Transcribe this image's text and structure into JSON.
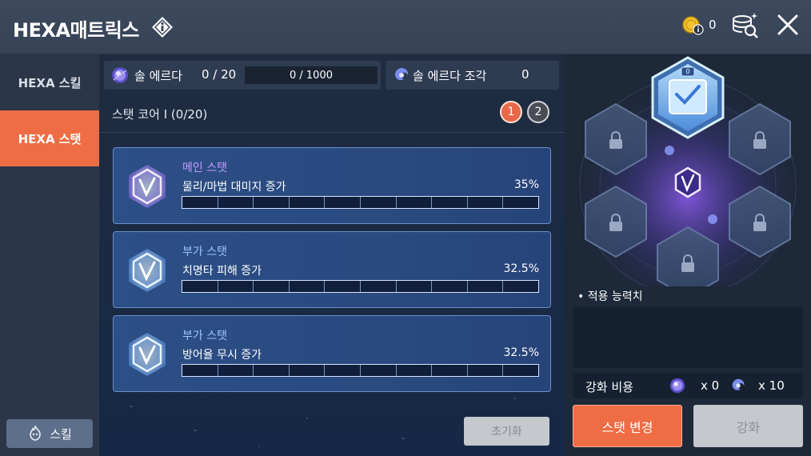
{
  "header": {
    "title": "HEXA매트릭스",
    "info_icon": "info-diamond-icon",
    "coin_count": "0",
    "close_icon": "close-icon"
  },
  "sidebar": {
    "tabs": [
      {
        "label": "HEXA 스킬",
        "active": false
      },
      {
        "label": "HEXA 스탯",
        "active": true
      }
    ],
    "skill_button": "스킬"
  },
  "resources": {
    "sol_erda_label": "솔 에르다",
    "sol_erda_value": "0 / 20",
    "sol_erda_gauge": "0 / 1000",
    "fragment_label": "솔 에르다 조각",
    "fragment_value": "0"
  },
  "core": {
    "title": "스탯 코어 I (0/20)",
    "pages": [
      "1",
      "2"
    ],
    "active_page": "1"
  },
  "stats": [
    {
      "type": "메인 스탯",
      "name": "물리/마법 대미지 증가",
      "value": "35%",
      "type_color": "#c79cff",
      "level": 0
    },
    {
      "type": "부가 스탯",
      "name": "치명타 피해 증가",
      "value": "32.5%",
      "type_color": "#9ec4ff",
      "level": 0
    },
    {
      "type": "부가 스탯",
      "name": "방어율 무시 증가",
      "value": "32.5%",
      "type_color": "#9ec4ff",
      "level": 0
    }
  ],
  "reset_button": "초기화",
  "matrix": {
    "active_slot_level": "0"
  },
  "applied": {
    "label": "• 적용 능력치"
  },
  "cost": {
    "label": "강화 비용",
    "sol_erda": "x 0",
    "fragment": "x 10"
  },
  "buttons": {
    "change": "스탯 변경",
    "enhance": "강화"
  },
  "colors": {
    "accent": "#ee6d45",
    "panel": "#2b3648",
    "card": "#2c4f86"
  }
}
